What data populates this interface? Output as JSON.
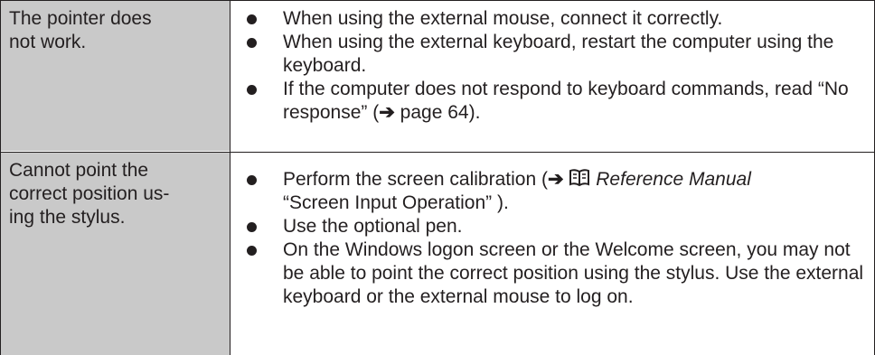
{
  "rows": [
    {
      "problem": "The pointer does\nnot work.",
      "solutions": [
        "When using the external mouse, connect it correctly.",
        "When using the external keyboard, restart the computer using the keyboard.",
        {
          "before": "If the computer does not respond to keyboard commands, read “No response” (",
          "arrow": "➔",
          "after": " page 64)."
        }
      ]
    },
    {
      "problem": "Cannot point the\ncorrect position us-\ning the stylus.",
      "solutions": [
        {
          "before": "Perform the screen calibration (",
          "arrow": "➔",
          "manual": "Reference Manual",
          "after": "“Screen Input Operation” )."
        },
        "Use the optional pen.",
        "On the Windows logon screen or the Welcome screen, you may not be able to point the correct position using the stylus. Use the external keyboard or the external mouse to log on."
      ]
    }
  ],
  "icons": {
    "bullet": "filled-circle",
    "arrow": "right-arrow-icon",
    "manual": "book-icon"
  },
  "colors": {
    "problem_cell_bg": "#c9c9c9",
    "text": "#231f20",
    "rule": "#231f20"
  }
}
